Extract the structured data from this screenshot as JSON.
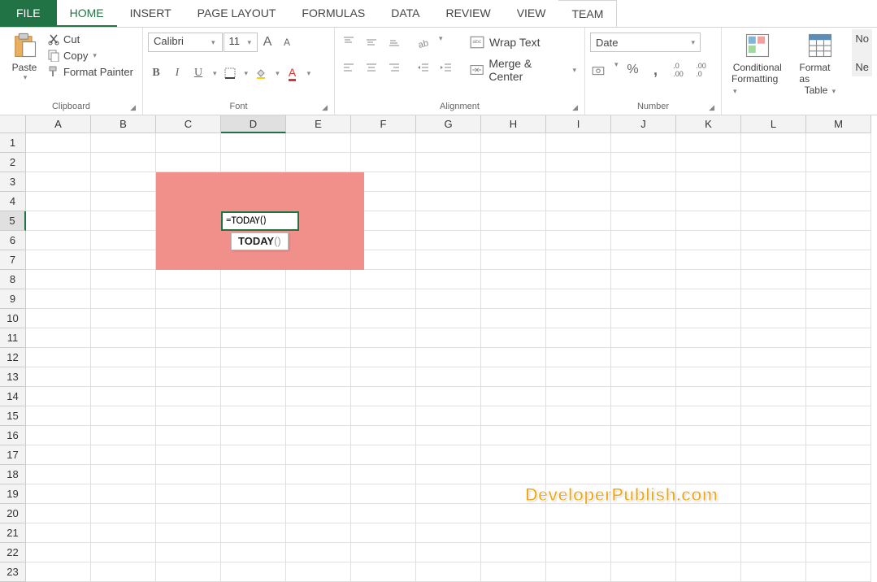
{
  "tabs": {
    "file": "FILE",
    "home": "HOME",
    "insert": "INSERT",
    "page_layout": "PAGE LAYOUT",
    "formulas": "FORMULAS",
    "data": "DATA",
    "review": "REVIEW",
    "view": "VIEW",
    "team": "TEAM"
  },
  "clipboard": {
    "paste": "Paste",
    "cut": "Cut",
    "copy": "Copy",
    "format_painter": "Format Painter",
    "group_label": "Clipboard"
  },
  "font": {
    "name": "Calibri",
    "size": "11",
    "group_label": "Font"
  },
  "alignment": {
    "wrap_text": "Wrap Text",
    "merge_center": "Merge & Center",
    "group_label": "Alignment"
  },
  "number": {
    "format": "Date",
    "group_label": "Number"
  },
  "styles": {
    "conditional": "Conditional",
    "formatting": "Formatting",
    "format_as": "Format as",
    "table": "Table",
    "no": "No",
    "ne": "Ne"
  },
  "grid": {
    "columns": [
      "A",
      "B",
      "C",
      "D",
      "E",
      "F",
      "G",
      "H",
      "I",
      "J",
      "K",
      "L",
      "M"
    ],
    "rows": [
      "1",
      "2",
      "3",
      "4",
      "5",
      "6",
      "7",
      "8",
      "9",
      "10",
      "11",
      "12",
      "13",
      "14",
      "15",
      "16",
      "17",
      "18",
      "19",
      "20",
      "21",
      "22",
      "23"
    ],
    "selected_col": "D",
    "selected_row": "5",
    "edit_value": "=TODAY()",
    "tooltip_bold": "TODAY",
    "tooltip_light": "()"
  },
  "watermark": "DeveloperPublish.com"
}
